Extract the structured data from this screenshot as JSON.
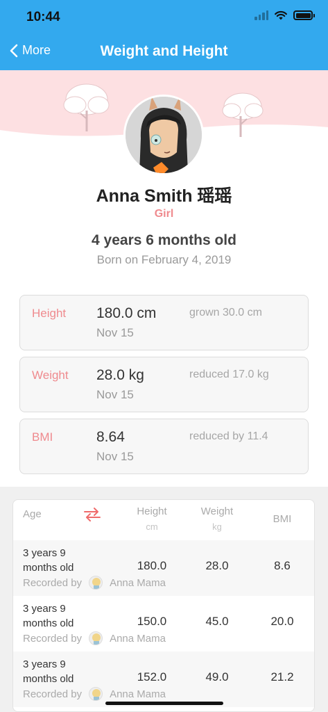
{
  "status_bar": {
    "time": "10:44"
  },
  "nav": {
    "back_label": "More",
    "title": "Weight and Height"
  },
  "profile": {
    "name": "Anna Smith 瑶瑶",
    "gender": "Girl",
    "age": "4 years 6 months old",
    "born": "Born on February 4, 2019"
  },
  "cards": [
    {
      "label": "Height",
      "value": "180.0 cm",
      "date": "Nov 15",
      "change": "grown 30.0 cm"
    },
    {
      "label": "Weight",
      "value": "28.0 kg",
      "date": "Nov 15",
      "change": "reduced 17.0 kg"
    },
    {
      "label": "BMI",
      "value": "8.64",
      "date": "Nov 15",
      "change": "reduced by 11.4"
    }
  ],
  "table": {
    "headers": {
      "age": "Age",
      "height": "Height",
      "height_unit": "cm",
      "weight": "Weight",
      "weight_unit": "kg",
      "bmi": "BMI"
    },
    "recorded_by_label": "Recorded by",
    "rows": [
      {
        "age": "3 years 9 months old",
        "recorder": "Anna Mama",
        "height": "180.0",
        "weight": "28.0",
        "bmi": "8.6"
      },
      {
        "age": "3 years 9 months old",
        "recorder": "Anna Mama",
        "height": "150.0",
        "weight": "45.0",
        "bmi": "20.0"
      },
      {
        "age": "3 years 9 months old",
        "recorder": "Anna Mama",
        "height": "152.0",
        "weight": "49.0",
        "bmi": "21.2"
      }
    ]
  },
  "colors": {
    "nav_blue": "#33a9ee",
    "accent_pink": "#ef8a8e",
    "banner_pink": "#fde0e2"
  }
}
